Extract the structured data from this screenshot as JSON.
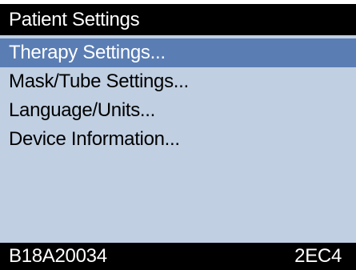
{
  "screen": {
    "title": "Patient Settings",
    "menu": {
      "selected_index": 0,
      "items": [
        {
          "label": "Therapy Settings..."
        },
        {
          "label": "Mask/Tube Settings..."
        },
        {
          "label": "Language/Units..."
        },
        {
          "label": "Device Information..."
        }
      ]
    },
    "status": {
      "left": "B18A20034",
      "right": "2EC4"
    }
  },
  "colors": {
    "background": "#c0cfe2",
    "bars": "#000000",
    "highlight": "#5a7db4"
  }
}
